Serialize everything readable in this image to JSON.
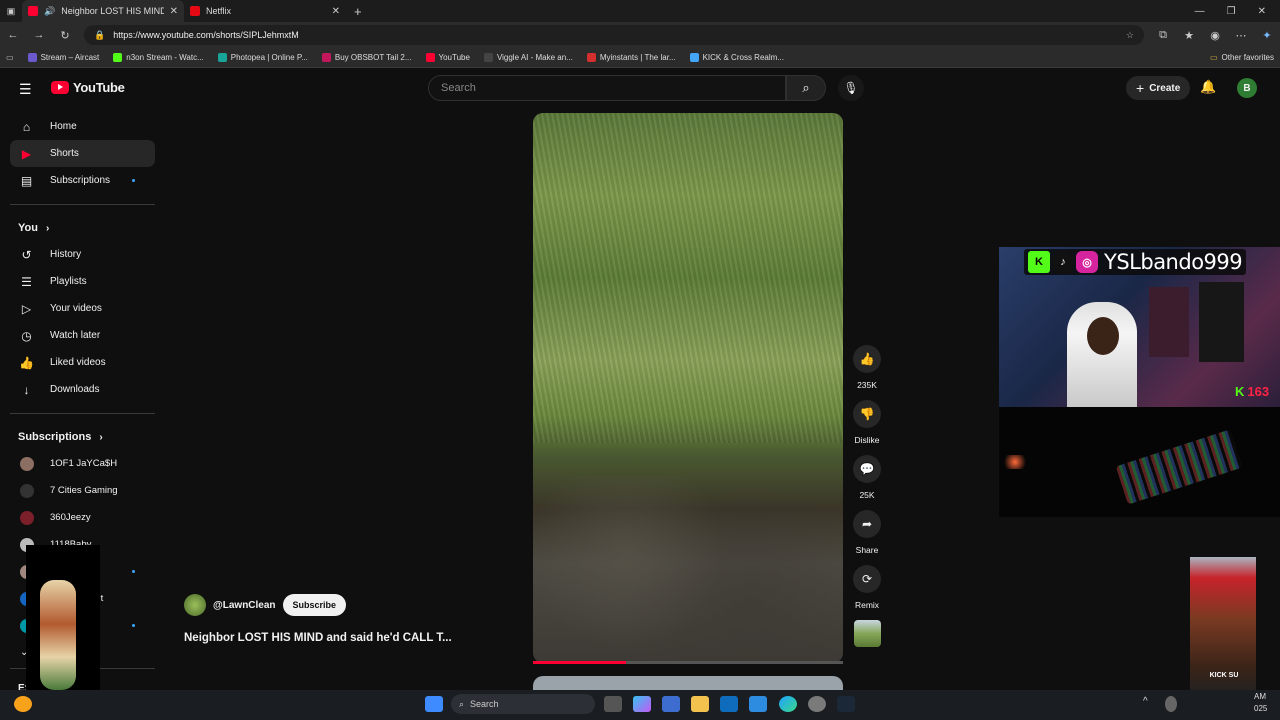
{
  "browser": {
    "tabs": [
      {
        "title": "Neighbor LOST HIS MIND and...",
        "color": "#ff0033"
      },
      {
        "title": "Netflix",
        "color": "#e50914"
      }
    ],
    "url": "https://www.youtube.com/shorts/SIPLJehmxtM",
    "bookmarks": [
      {
        "label": "Stream – Aircast",
        "color": "#6a5acd"
      },
      {
        "label": "n3on Stream - Watc...",
        "color": "#53fc18"
      },
      {
        "label": "Photopea | Online P...",
        "color": "#18a497"
      },
      {
        "label": "Buy OBSBOT Tail 2...",
        "color": "#c2185b"
      },
      {
        "label": "YouTube",
        "color": "#ff0033"
      },
      {
        "label": "Viggle AI - Make an...",
        "color": "#222222"
      },
      {
        "label": "Myinstants | The lar...",
        "color": "#d32f2f"
      },
      {
        "label": "KICK & Cross Realm...",
        "color": "#42a5f5"
      }
    ],
    "other_favorites": "Other favorites"
  },
  "youtube": {
    "logo_text": "YouTube",
    "search_placeholder": "Search",
    "create_label": "Create",
    "avatar_letter": "B"
  },
  "sidebar": {
    "main": [
      {
        "label": "Home",
        "icon": "home-icon",
        "glyph": "⌂"
      },
      {
        "label": "Shorts",
        "icon": "shorts-icon",
        "glyph": "▶"
      },
      {
        "label": "Subscriptions",
        "icon": "subscriptions-icon",
        "glyph": "▤"
      }
    ],
    "you_header": "You",
    "you": [
      {
        "label": "History",
        "icon": "history-icon",
        "glyph": "↺"
      },
      {
        "label": "Playlists",
        "icon": "playlists-icon",
        "glyph": "☰"
      },
      {
        "label": "Your videos",
        "icon": "your-videos-icon",
        "glyph": "▷"
      },
      {
        "label": "Watch later",
        "icon": "watch-later-icon",
        "glyph": "◷"
      },
      {
        "label": "Liked videos",
        "icon": "liked-videos-icon",
        "glyph": "👍"
      },
      {
        "label": "Downloads",
        "icon": "downloads-icon",
        "glyph": "↓"
      }
    ],
    "subs_header": "Subscriptions",
    "subs": [
      {
        "label": "1OF1 JaYCa$H",
        "color": "#8d6e63"
      },
      {
        "label": "7 Cities Gaming",
        "color": "#333333"
      },
      {
        "label": "360Jeezy",
        "color": "#7b1f2a"
      },
      {
        "label": "1118Baby",
        "color": "#bbbbbb"
      },
      {
        "label": "Ac",
        "color": "#a1887f"
      },
      {
        "label": "ont",
        "color": "#1565c0"
      },
      {
        "label": "",
        "color": "#0097a7"
      }
    ],
    "explore_partial": "Exp"
  },
  "short": {
    "channel": "@LawnClean",
    "subscribe": "Subscribe",
    "title": "Neighbor LOST HIS MIND and said he'd CALL T...",
    "progress": 0.3,
    "actions": [
      {
        "label": "235K",
        "icon": "like-icon",
        "glyph": "👍"
      },
      {
        "label": "Dislike",
        "icon": "dislike-icon",
        "glyph": "👎"
      },
      {
        "label": "25K",
        "icon": "comments-icon",
        "glyph": "💬"
      },
      {
        "label": "Share",
        "icon": "share-icon",
        "glyph": "➦"
      },
      {
        "label": "Remix",
        "icon": "remix-icon",
        "glyph": "⟳"
      }
    ]
  },
  "overlay": {
    "handle": "YSLbando999",
    "kick_count": "163",
    "meme_caption": "KICK SU"
  },
  "taskbar": {
    "search_placeholder": "Search",
    "time_partial": "AM",
    "date_partial": "025"
  }
}
